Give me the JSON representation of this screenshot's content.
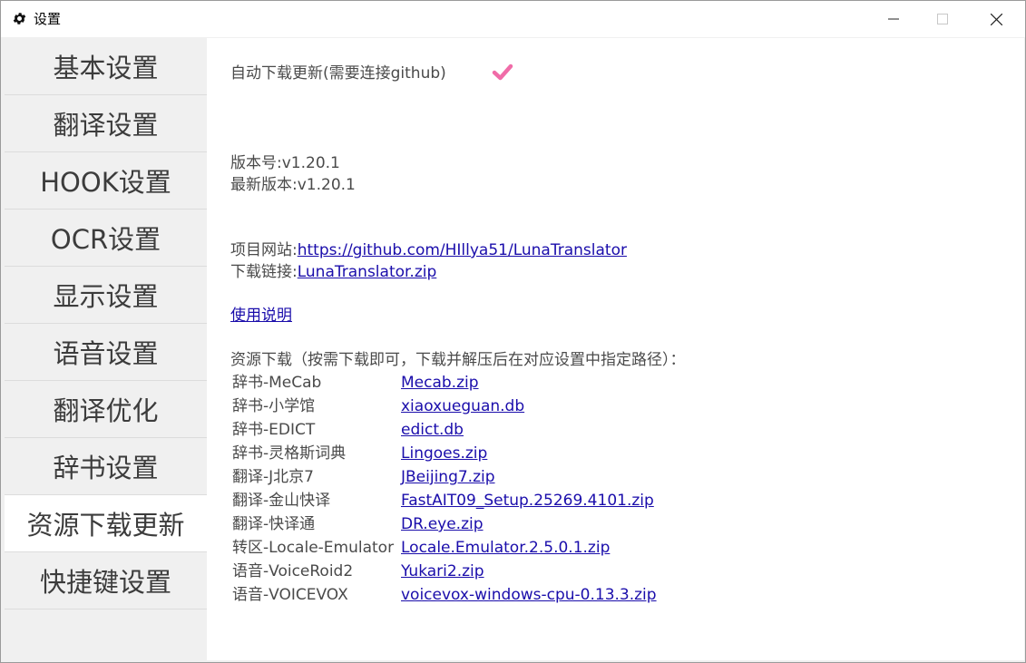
{
  "window": {
    "title": "设置",
    "icons": {
      "app": "gear-icon",
      "minimize": "minimize-icon",
      "maximize": "maximize-icon",
      "close": "close-icon"
    }
  },
  "sidebar": {
    "items": [
      {
        "label": "基本设置",
        "active": false
      },
      {
        "label": "翻译设置",
        "active": false
      },
      {
        "label": "HOOK设置",
        "active": false
      },
      {
        "label": "OCR设置",
        "active": false
      },
      {
        "label": "显示设置",
        "active": false
      },
      {
        "label": "语音设置",
        "active": false
      },
      {
        "label": "翻译优化",
        "active": false
      },
      {
        "label": "辞书设置",
        "active": false
      },
      {
        "label": "资源下载更新",
        "active": true
      },
      {
        "label": "快捷键设置",
        "active": false
      }
    ]
  },
  "main": {
    "auto_update_label": "自动下载更新(需要连接github)",
    "auto_update_checked": true,
    "accent_color": "#f06ca8",
    "version_line": "版本号:v1.20.1",
    "latest_version_line": "最新版本:v1.20.1",
    "project_site_label": "项目网站:",
    "project_site_link": "https://github.com/HIllya51/LunaTranslator",
    "download_link_label": "下载链接:",
    "download_link": "LunaTranslator.zip",
    "usage_link": "使用说明",
    "resources_header": "资源下载（按需下载即可，下载并解压后在对应设置中指定路径）：",
    "resources": [
      {
        "name": "辞书-MeCab",
        "file": "Mecab.zip"
      },
      {
        "name": "辞书-小学馆",
        "file": "xiaoxueguan.db"
      },
      {
        "name": "辞书-EDICT",
        "file": "edict.db"
      },
      {
        "name": "辞书-灵格斯词典",
        "file": "Lingoes.zip"
      },
      {
        "name": "翻译-J北京7",
        "file": "JBeijing7.zip"
      },
      {
        "name": "翻译-金山快译",
        "file": "FastAIT09_Setup.25269.4101.zip"
      },
      {
        "name": "翻译-快译通",
        "file": "DR.eye.zip"
      },
      {
        "name": "转区-Locale-Emulator",
        "file": "Locale.Emulator.2.5.0.1.zip"
      },
      {
        "name": "语音-VoiceRoid2",
        "file": "Yukari2.zip"
      },
      {
        "name": "语音-VOICEVOX",
        "file": "voicevox-windows-cpu-0.13.3.zip"
      }
    ]
  }
}
